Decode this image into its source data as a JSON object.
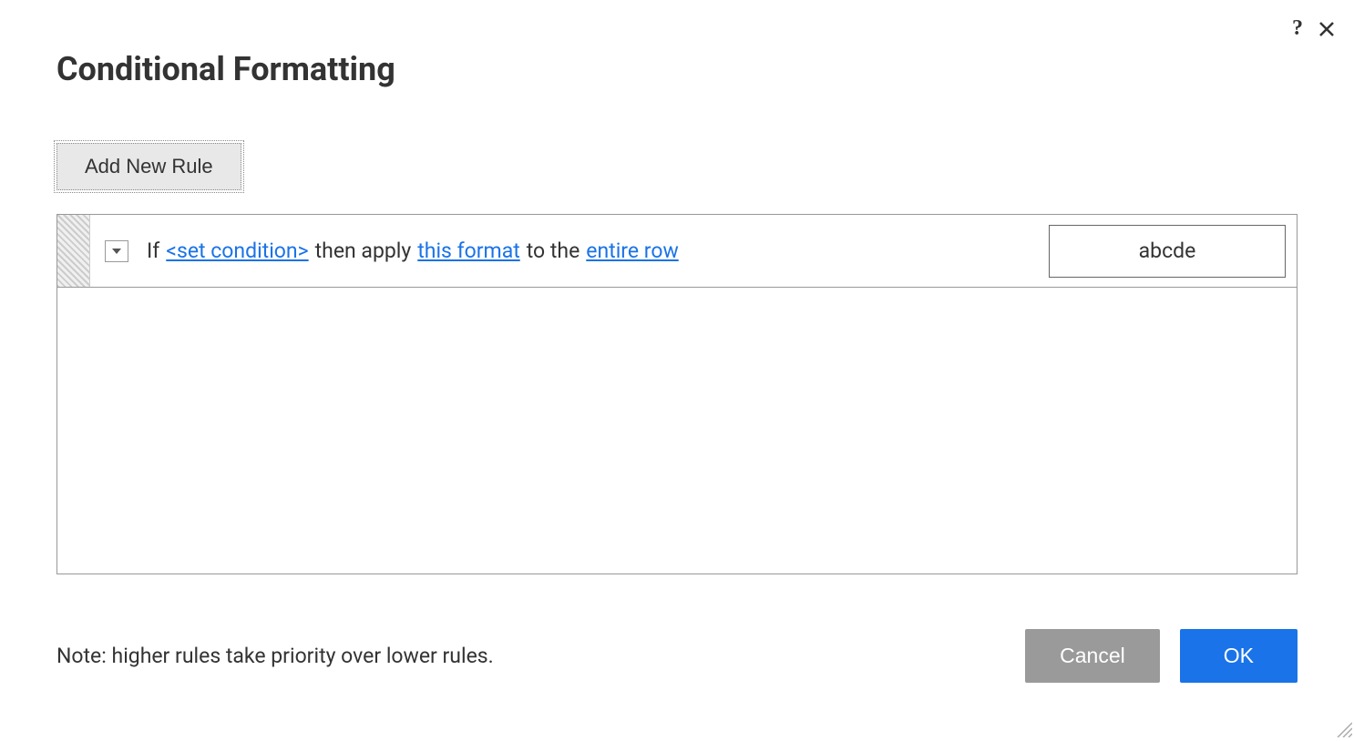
{
  "dialog": {
    "title": "Conditional Formatting",
    "add_rule_label": "Add New Rule",
    "note": "Note: higher rules take priority over lower rules.",
    "cancel_label": "Cancel",
    "ok_label": "OK"
  },
  "rule": {
    "prefix": "If",
    "condition_link": "<set condition>",
    "apply_text": "then apply",
    "format_link": "this format",
    "to_text": "to the",
    "scope_link": "entire row",
    "preview_text": "abcde"
  },
  "icons": {
    "help": "?",
    "close": "close",
    "dropdown": "chevron-down"
  }
}
